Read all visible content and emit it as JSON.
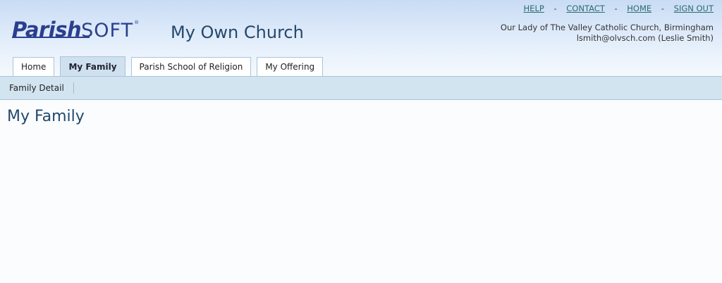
{
  "logo": {
    "part1": "Parish",
    "part2": "SOFT",
    "mark": "®"
  },
  "site_title": "My Own Church",
  "top_links": [
    {
      "label": "HELP"
    },
    {
      "label": "CONTACT"
    },
    {
      "label": "HOME"
    },
    {
      "label": "SIGN OUT"
    }
  ],
  "separator": "-",
  "account": {
    "church": "Our Lady of The Valley Catholic Church, Birmingham",
    "user": "lsmith@olvsch.com (Leslie Smith)"
  },
  "tabs": [
    {
      "label": "Home",
      "active": false
    },
    {
      "label": "My Family",
      "active": true
    },
    {
      "label": "Parish School of Religion",
      "active": false
    },
    {
      "label": "My Offering",
      "active": false
    }
  ],
  "subnav": {
    "items": [
      {
        "label": "Family Detail"
      }
    ]
  },
  "page": {
    "title": "My Family"
  },
  "colors": {
    "header_top": "#c9dcf5",
    "logo": "#2a3f8e",
    "title": "#24496b",
    "link": "#2a6a73",
    "subnav_bg": "#d3e4f1",
    "active_tab_bg": "#cfe1ef"
  }
}
